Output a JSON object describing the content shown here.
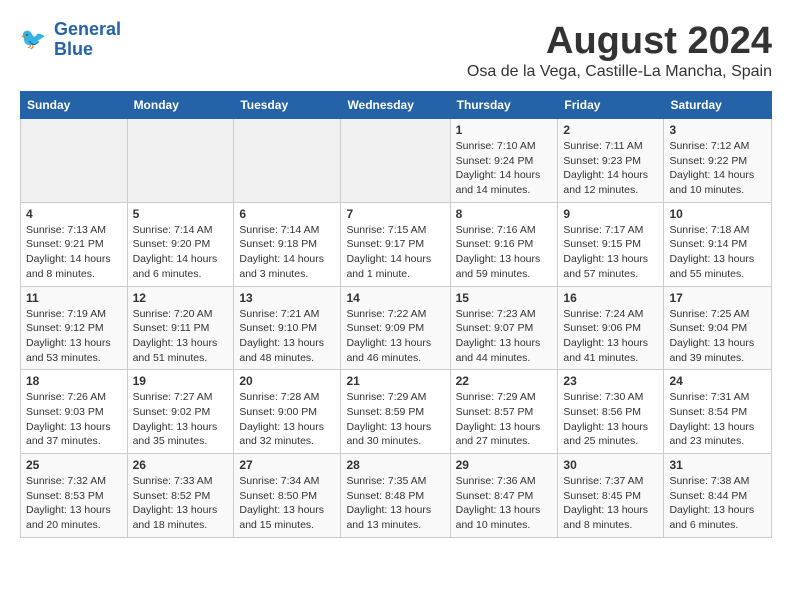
{
  "header": {
    "logo_line1": "General",
    "logo_line2": "Blue",
    "month": "August 2024",
    "location": "Osa de la Vega, Castille-La Mancha, Spain"
  },
  "weekdays": [
    "Sunday",
    "Monday",
    "Tuesday",
    "Wednesday",
    "Thursday",
    "Friday",
    "Saturday"
  ],
  "weeks": [
    [
      {
        "day": "",
        "empty": true
      },
      {
        "day": "",
        "empty": true
      },
      {
        "day": "",
        "empty": true
      },
      {
        "day": "",
        "empty": true
      },
      {
        "day": "1",
        "sunrise": "7:10 AM",
        "sunset": "9:24 PM",
        "daylight": "14 hours and 14 minutes."
      },
      {
        "day": "2",
        "sunrise": "7:11 AM",
        "sunset": "9:23 PM",
        "daylight": "14 hours and 12 minutes."
      },
      {
        "day": "3",
        "sunrise": "7:12 AM",
        "sunset": "9:22 PM",
        "daylight": "14 hours and 10 minutes."
      }
    ],
    [
      {
        "day": "4",
        "sunrise": "7:13 AM",
        "sunset": "9:21 PM",
        "daylight": "14 hours and 8 minutes."
      },
      {
        "day": "5",
        "sunrise": "7:14 AM",
        "sunset": "9:20 PM",
        "daylight": "14 hours and 6 minutes."
      },
      {
        "day": "6",
        "sunrise": "7:14 AM",
        "sunset": "9:18 PM",
        "daylight": "14 hours and 3 minutes."
      },
      {
        "day": "7",
        "sunrise": "7:15 AM",
        "sunset": "9:17 PM",
        "daylight": "14 hours and 1 minute."
      },
      {
        "day": "8",
        "sunrise": "7:16 AM",
        "sunset": "9:16 PM",
        "daylight": "13 hours and 59 minutes."
      },
      {
        "day": "9",
        "sunrise": "7:17 AM",
        "sunset": "9:15 PM",
        "daylight": "13 hours and 57 minutes."
      },
      {
        "day": "10",
        "sunrise": "7:18 AM",
        "sunset": "9:14 PM",
        "daylight": "13 hours and 55 minutes."
      }
    ],
    [
      {
        "day": "11",
        "sunrise": "7:19 AM",
        "sunset": "9:12 PM",
        "daylight": "13 hours and 53 minutes."
      },
      {
        "day": "12",
        "sunrise": "7:20 AM",
        "sunset": "9:11 PM",
        "daylight": "13 hours and 51 minutes."
      },
      {
        "day": "13",
        "sunrise": "7:21 AM",
        "sunset": "9:10 PM",
        "daylight": "13 hours and 48 minutes."
      },
      {
        "day": "14",
        "sunrise": "7:22 AM",
        "sunset": "9:09 PM",
        "daylight": "13 hours and 46 minutes."
      },
      {
        "day": "15",
        "sunrise": "7:23 AM",
        "sunset": "9:07 PM",
        "daylight": "13 hours and 44 minutes."
      },
      {
        "day": "16",
        "sunrise": "7:24 AM",
        "sunset": "9:06 PM",
        "daylight": "13 hours and 41 minutes."
      },
      {
        "day": "17",
        "sunrise": "7:25 AM",
        "sunset": "9:04 PM",
        "daylight": "13 hours and 39 minutes."
      }
    ],
    [
      {
        "day": "18",
        "sunrise": "7:26 AM",
        "sunset": "9:03 PM",
        "daylight": "13 hours and 37 minutes."
      },
      {
        "day": "19",
        "sunrise": "7:27 AM",
        "sunset": "9:02 PM",
        "daylight": "13 hours and 35 minutes."
      },
      {
        "day": "20",
        "sunrise": "7:28 AM",
        "sunset": "9:00 PM",
        "daylight": "13 hours and 32 minutes."
      },
      {
        "day": "21",
        "sunrise": "7:29 AM",
        "sunset": "8:59 PM",
        "daylight": "13 hours and 30 minutes."
      },
      {
        "day": "22",
        "sunrise": "7:29 AM",
        "sunset": "8:57 PM",
        "daylight": "13 hours and 27 minutes."
      },
      {
        "day": "23",
        "sunrise": "7:30 AM",
        "sunset": "8:56 PM",
        "daylight": "13 hours and 25 minutes."
      },
      {
        "day": "24",
        "sunrise": "7:31 AM",
        "sunset": "8:54 PM",
        "daylight": "13 hours and 23 minutes."
      }
    ],
    [
      {
        "day": "25",
        "sunrise": "7:32 AM",
        "sunset": "8:53 PM",
        "daylight": "13 hours and 20 minutes."
      },
      {
        "day": "26",
        "sunrise": "7:33 AM",
        "sunset": "8:52 PM",
        "daylight": "13 hours and 18 minutes."
      },
      {
        "day": "27",
        "sunrise": "7:34 AM",
        "sunset": "8:50 PM",
        "daylight": "13 hours and 15 minutes."
      },
      {
        "day": "28",
        "sunrise": "7:35 AM",
        "sunset": "8:48 PM",
        "daylight": "13 hours and 13 minutes."
      },
      {
        "day": "29",
        "sunrise": "7:36 AM",
        "sunset": "8:47 PM",
        "daylight": "13 hours and 10 minutes."
      },
      {
        "day": "30",
        "sunrise": "7:37 AM",
        "sunset": "8:45 PM",
        "daylight": "13 hours and 8 minutes."
      },
      {
        "day": "31",
        "sunrise": "7:38 AM",
        "sunset": "8:44 PM",
        "daylight": "13 hours and 6 minutes."
      }
    ]
  ],
  "labels": {
    "sunrise": "Sunrise:",
    "sunset": "Sunset:",
    "daylight": "Daylight:"
  }
}
